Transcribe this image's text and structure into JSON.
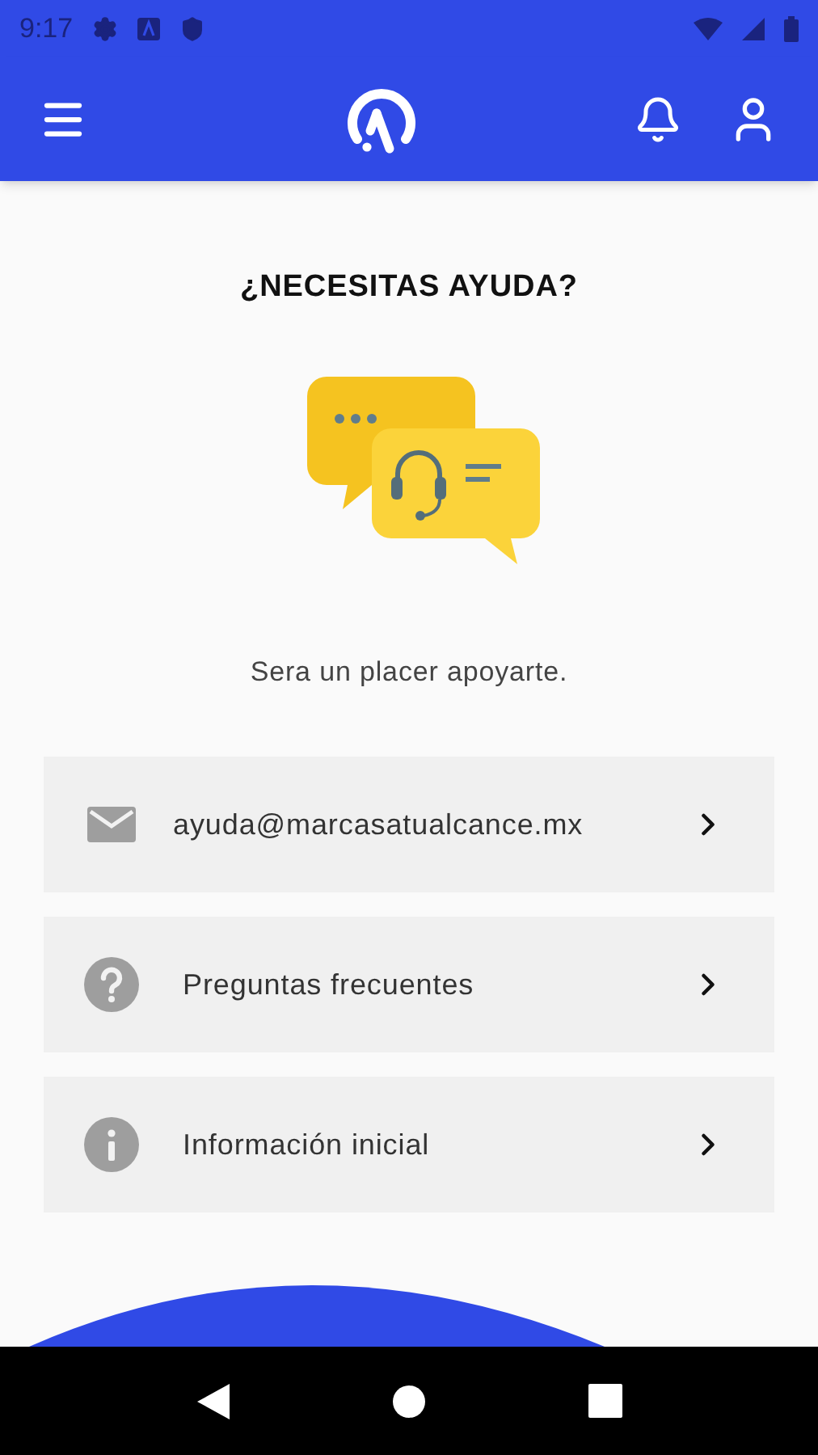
{
  "status_bar": {
    "time": "9:17"
  },
  "title": "¿NECESITAS AYUDA?",
  "subtitle": "Sera un placer apoyarte.",
  "options": [
    {
      "kind": "mail",
      "label": "ayuda@marcasatualcance.mx"
    },
    {
      "kind": "question",
      "label": "Preguntas frecuentes"
    },
    {
      "kind": "info",
      "label": "Información inicial"
    }
  ]
}
